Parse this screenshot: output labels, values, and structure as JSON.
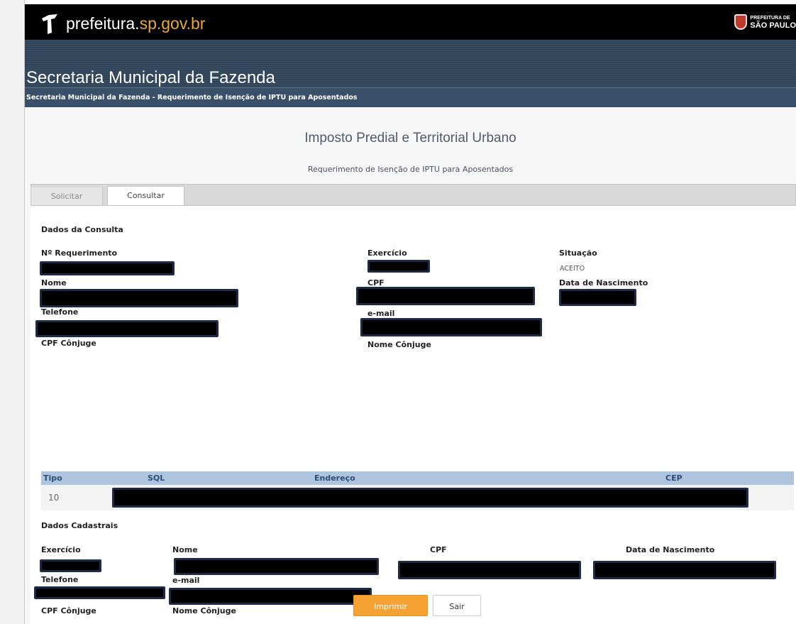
{
  "header": {
    "portal_prefix": "prefeitura.",
    "portal_suffix": "sp.gov.br",
    "city_top": "PREFEITURA DE",
    "city_bottom": "SÃO PAULO"
  },
  "banner": {
    "title": "Secretaria Municipal da Fazenda",
    "subtitle": "Secretaria Municipal da Fazenda - Requerimento de Isenção de IPTU para Aposentados"
  },
  "page": {
    "title": "Imposto Predial e Territorial Urbano",
    "subtitle": "Requerimento de Isenção de IPTU para Aposentados"
  },
  "tabs": [
    "Solicitar",
    "Consultar"
  ],
  "consulta": {
    "section_title": "Dados da Consulta",
    "labels": {
      "requerimento": "Nº Requerimento",
      "exercicio": "Exercício",
      "situacao": "Situação",
      "nome": "Nome",
      "cpf": "CPF",
      "nascimento": "Data de Nascimento",
      "telefone": "Telefone",
      "email": "e-mail",
      "cpf_conjuge": "CPF Cônjuge",
      "nome_conjuge": "Nome Cônjuge"
    },
    "situacao_value": "ACEITO"
  },
  "table": {
    "headers": [
      "Tipo",
      "SQL",
      "Endereço",
      "CEP"
    ],
    "row": {
      "tipo": "10"
    }
  },
  "cadastrais": {
    "section_title": "Dados Cadastrais",
    "labels": {
      "exercicio": "Exercício",
      "nome": "Nome",
      "cpf": "CPF",
      "nascimento": "Data de Nascimento",
      "telefone": "Telefone",
      "email": "e-mail",
      "cpf_conjuge": "CPF Cônjuge",
      "nome_conjuge": "Nome Cônjuge"
    }
  },
  "buttons": {
    "print": "Imprimir",
    "exit": "Sair"
  },
  "colors": {
    "accent": "#f5a233",
    "banner": "#2e4258",
    "subbar": "#3a5068",
    "table_header": "#aec4dc",
    "redaction": "#000000"
  }
}
